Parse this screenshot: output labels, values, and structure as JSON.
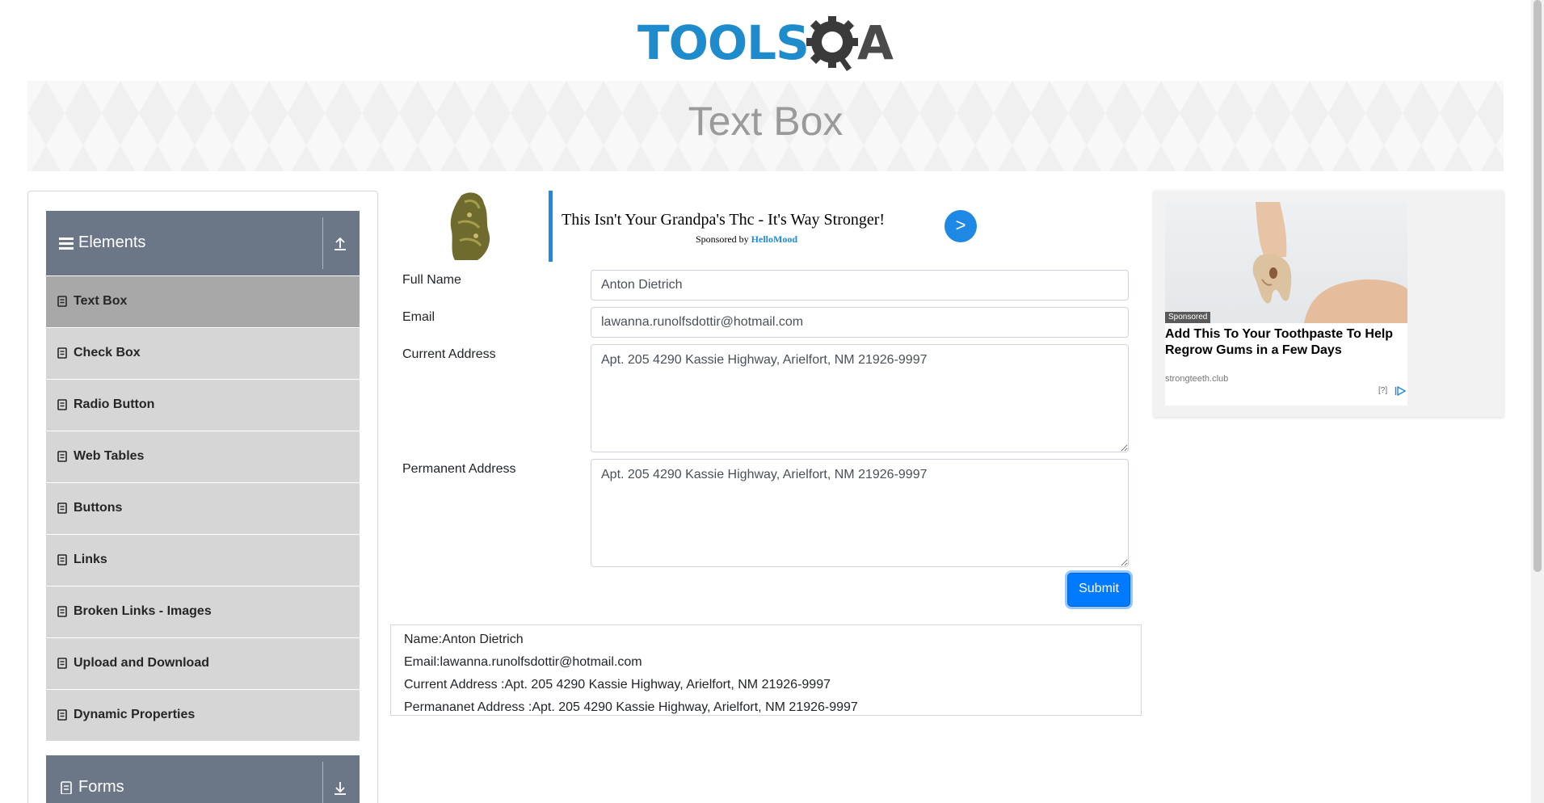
{
  "header": {
    "logo_main": "TOOLS",
    "logo_tail": "A"
  },
  "banner": {
    "title": "Text Box"
  },
  "sidebar": {
    "groups": [
      {
        "label": "Elements",
        "icon": "hamburger-icon",
        "toggle_icon": "collapse-up-icon"
      },
      {
        "label": "Forms",
        "icon": "clipboard-icon",
        "toggle_icon": "expand-down-icon"
      }
    ],
    "items": [
      {
        "label": "Text Box",
        "active": true
      },
      {
        "label": "Check Box"
      },
      {
        "label": "Radio Button"
      },
      {
        "label": "Web Tables"
      },
      {
        "label": "Buttons"
      },
      {
        "label": "Links"
      },
      {
        "label": "Broken Links - Images"
      },
      {
        "label": "Upload and Download"
      },
      {
        "label": "Dynamic Properties"
      }
    ]
  },
  "ad_strip": {
    "headline": "This Isn't Your Grandpa's Thc - It's Way Stronger!",
    "sponsor_prefix": "Sponsored by ",
    "sponsor_brand": "HelloMood",
    "arrow": ">",
    "brand_color": "#1e88e5"
  },
  "form": {
    "full_name_label": "Full Name",
    "full_name_value": "Anton Dietrich",
    "email_label": "Email",
    "email_value": "lawanna.runolfsdottir@hotmail.com",
    "current_address_label": "Current Address",
    "current_address_value": "Apt. 205 4290 Kassie Highway, Arielfort, NM 21926-9997",
    "permanent_address_label": "Permanent Address",
    "permanent_address_value": "Apt. 205 4290 Kassie Highway, Arielfort, NM 21926-9997",
    "submit_label": "Submit"
  },
  "output": {
    "name": "Name:Anton Dietrich",
    "email": "Email:lawanna.runolfsdottir@hotmail.com",
    "current_address": "Current Address :Apt. 205 4290 Kassie Highway, Arielfort, NM 21926-9997",
    "permanent_address": "Permananet Address :Apt. 205 4290 Kassie Highway, Arielfort, NM 21926-9997"
  },
  "right_ad": {
    "badge": "Sponsored",
    "title": "Add This To Your Toothpaste To Help Regrow Gums in a Few Days",
    "domain": "strongteeth.club",
    "choices": "[?]"
  },
  "colors": {
    "logo_blue": "#1e8ccc",
    "sidebar_header": "#6b7786",
    "submit_blue": "#007bff"
  }
}
